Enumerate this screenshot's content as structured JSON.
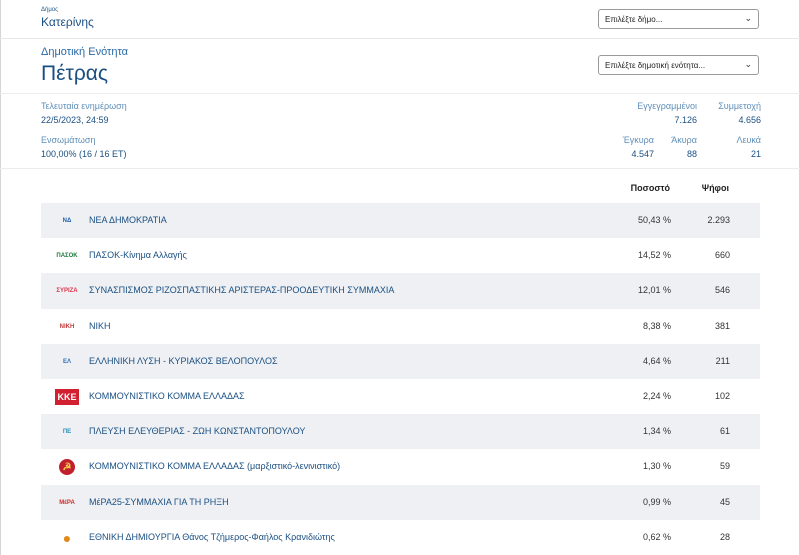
{
  "header": {
    "municipality_small": "Δήμος",
    "municipality": "Κατερίνης",
    "municipality_select_placeholder": "Επιλέξτε δήμο...",
    "unit_label": "Δημοτική Ενότητα",
    "unit_name": "Πέτρας",
    "unit_select_placeholder": "Επιλέξτε δημοτική ενότητα..."
  },
  "stats": {
    "last_update_label": "Τελευταία ενημέρωση",
    "last_update_value": "22/5/2023, 24:59",
    "integration_label": "Ενσωμάτωση",
    "integration_value": "100,00% (16 / 16 ΕΤ)",
    "registered_label": "Εγγεγραμμένοι",
    "registered_value": "7.126",
    "turnout_label": "Συμμετοχή",
    "turnout_value": "4.656",
    "valid_label": "Έγκυρα",
    "valid_value": "4.547",
    "invalid_label": "Άκυρα",
    "invalid_value": "88",
    "blank_label": "Λευκά",
    "blank_value": "21"
  },
  "table": {
    "percent_header": "Ποσοστό",
    "votes_header": "Ψήφοι",
    "rows": [
      {
        "logo": "nd-logo",
        "color": "#1f5fa8",
        "name": "ΝΕΑ ΔΗΜΟΚΡΑΤΙΑ",
        "percent": "50,43 %",
        "votes": "2.293"
      },
      {
        "logo": "pasok-logo",
        "color": "#1b7a3a",
        "name": "ΠΑΣΟΚ-Κίνημα Αλλαγής",
        "percent": "14,52 %",
        "votes": "660"
      },
      {
        "logo": "syriza-logo",
        "color": "#d9364e",
        "name": "ΣΥΝΑΣΠΙΣΜΟΣ ΡΙΖΟΣΠΑΣΤΙΚΗΣ ΑΡΙΣΤΕΡΑΣ-ΠΡΟΟΔΕΥΤΙΚΗ ΣΥΜΜΑΧΙΑ",
        "percent": "12,01 %",
        "votes": "546"
      },
      {
        "logo": "niki-logo",
        "color": "#c33b3b",
        "name": "ΝΙΚΗ",
        "percent": "8,38 %",
        "votes": "381"
      },
      {
        "logo": "elliniki-lysi-logo",
        "color": "#2f6fb5",
        "name": "ΕΛΛΗΝΙΚΗ ΛΥΣΗ - ΚΥΡΙΑΚΟΣ ΒΕΛΟΠΟΥΛΟΣ",
        "percent": "4,64 %",
        "votes": "211"
      },
      {
        "logo": "kke-logo",
        "color": "#d1202f",
        "name": "ΚΟΜΜΟΥΝΙΣΤΙΚΟ ΚΟΜΜΑ ΕΛΛΑΔΑΣ",
        "percent": "2,24 %",
        "votes": "102"
      },
      {
        "logo": "plefsi-logo",
        "color": "#2a8fb8",
        "name": "ΠΛΕΥΣΗ ΕΛΕΥΘΕΡΙΑΣ - ΖΩΗ ΚΩΝΣΤΑΝΤΟΠΟΥΛΟΥ",
        "percent": "1,34 %",
        "votes": "61"
      },
      {
        "logo": "kke-ml-logo",
        "color": "#c21f2e",
        "name": "ΚΟΜΜΟΥΝΙΣΤΙΚΟ ΚΟΜΜΑ ΕΛΛΑΔΑΣ (μαρξιστικό-λενινιστικό)",
        "percent": "1,30 %",
        "votes": "59"
      },
      {
        "logo": "mera25-logo",
        "color": "#d02b2b",
        "name": "ΜέΡΑ25-ΣΥΜΜΑΧΙΑ ΓΙΑ ΤΗ ΡΗΞΗ",
        "percent": "0,99 %",
        "votes": "45"
      },
      {
        "logo": "ethniki-dimiourgia-logo",
        "color": "#e08a1a",
        "name": "ΕΘΝΙΚΗ ΔΗΜΙΟΥΡΓΙΑ Θάνος Τζήμερος-Φαήλος Κρανιδιώτης",
        "percent": "0,62 %",
        "votes": "28"
      }
    ]
  }
}
